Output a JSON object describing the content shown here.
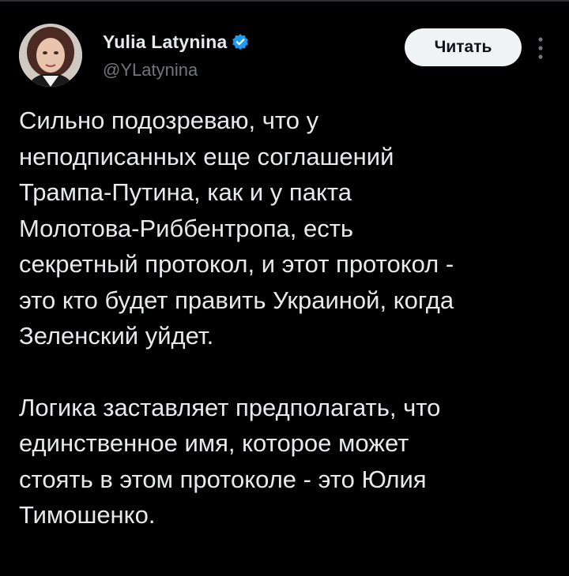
{
  "author": {
    "display_name": "Yulia Latynina",
    "handle": "@YLatynina",
    "verified": true
  },
  "header": {
    "follow_label": "Читать"
  },
  "tweet": {
    "paragraphs": [
      "Сильно подозреваю, что у\nнеподписанных еще соглашений\nТрампа-Путина, как и у пакта\nМолотова-Риббентропа, есть\nсекретный протокол, и этот протокол -\nэто кто будет править Украиной, когда\nЗеленский уйдет.",
      "Логика заставляет предполагать, что\nединственное имя, которое может\nстоять в этом протоколе - это Юлия\nТимошенко."
    ]
  },
  "icons": {
    "verified": "verified-badge-icon",
    "more": "more-options-icon"
  },
  "colors": {
    "background": "#000000",
    "text_primary": "#e7e9ea",
    "text_secondary": "#71767b",
    "verified_blue": "#1d9bf0",
    "button_bg": "#eff3f4",
    "button_text": "#0f1419"
  }
}
